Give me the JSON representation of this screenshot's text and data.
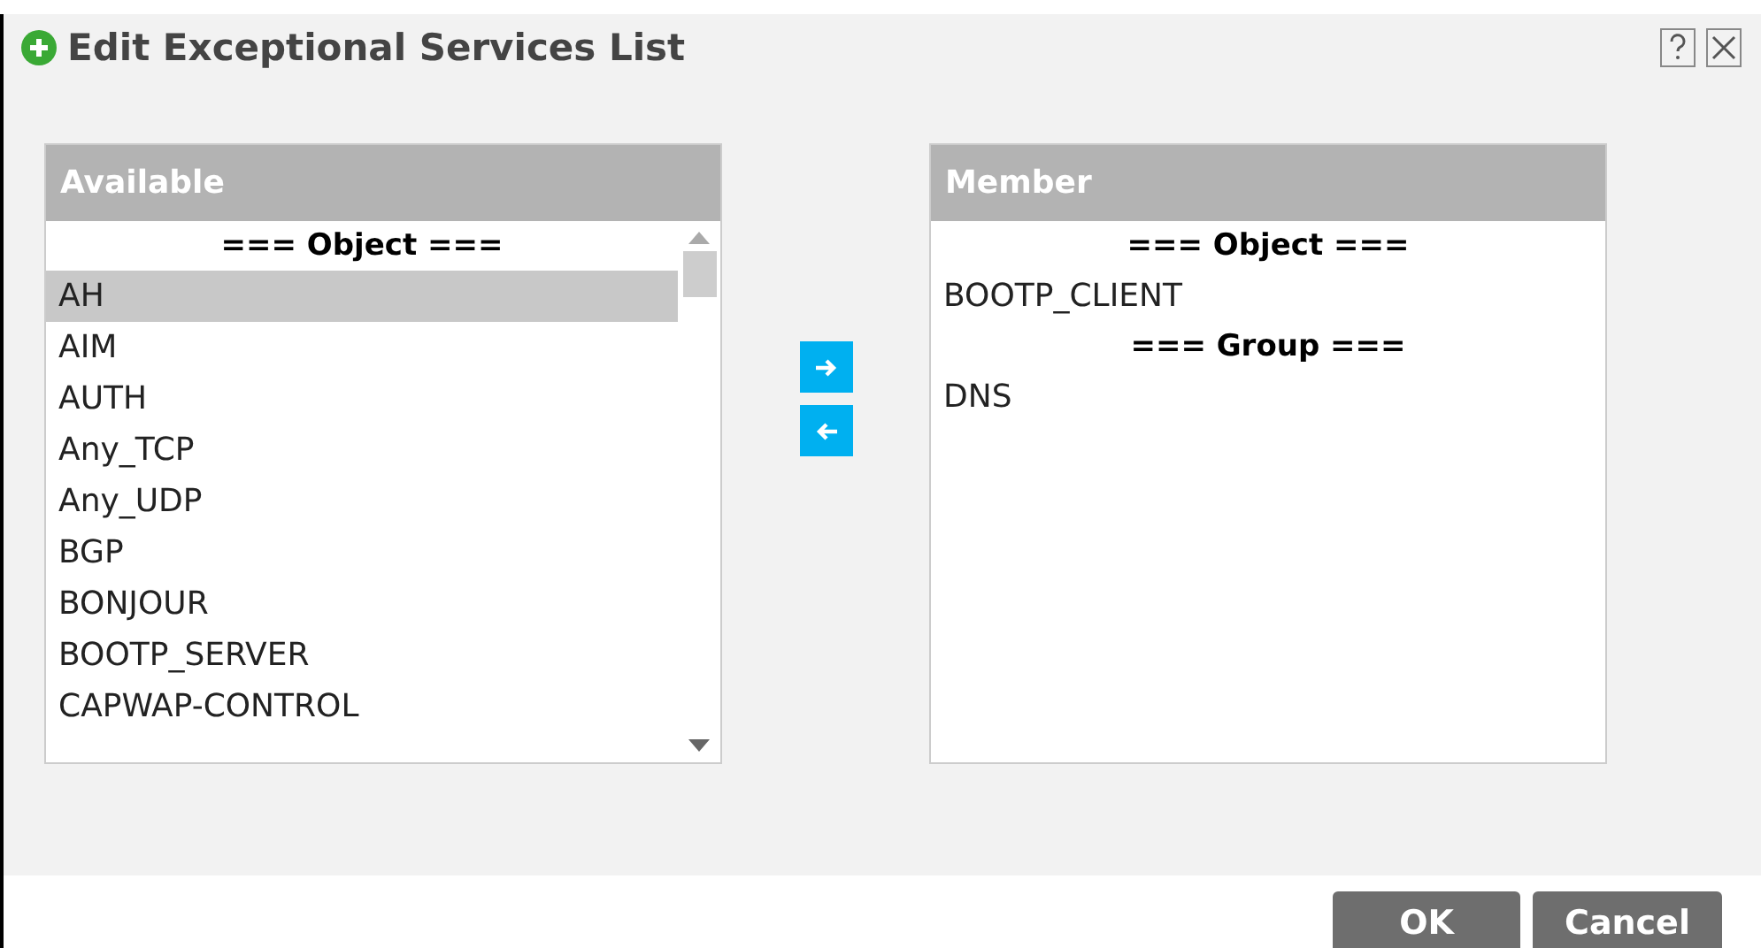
{
  "dialog": {
    "title": "Edit Exceptional Services List",
    "available": {
      "heading": "Available",
      "items": [
        {
          "kind": "section",
          "label": "=== Object ==="
        },
        {
          "kind": "item",
          "label": "AH",
          "selected": true
        },
        {
          "kind": "item",
          "label": "AIM",
          "selected": false
        },
        {
          "kind": "item",
          "label": "AUTH",
          "selected": false
        },
        {
          "kind": "item",
          "label": "Any_TCP",
          "selected": false
        },
        {
          "kind": "item",
          "label": "Any_UDP",
          "selected": false
        },
        {
          "kind": "item",
          "label": "BGP",
          "selected": false
        },
        {
          "kind": "item",
          "label": "BONJOUR",
          "selected": false
        },
        {
          "kind": "item",
          "label": "BOOTP_SERVER",
          "selected": false
        },
        {
          "kind": "item",
          "label": "CAPWAP-CONTROL",
          "selected": false
        }
      ]
    },
    "member": {
      "heading": "Member",
      "items": [
        {
          "kind": "section",
          "label": "=== Object ==="
        },
        {
          "kind": "item",
          "label": "BOOTP_CLIENT",
          "selected": false
        },
        {
          "kind": "section",
          "label": "=== Group ==="
        },
        {
          "kind": "item",
          "label": "DNS",
          "selected": false
        }
      ]
    },
    "buttons": [
      {
        "label": "OK"
      },
      {
        "label": "Cancel"
      }
    ]
  }
}
